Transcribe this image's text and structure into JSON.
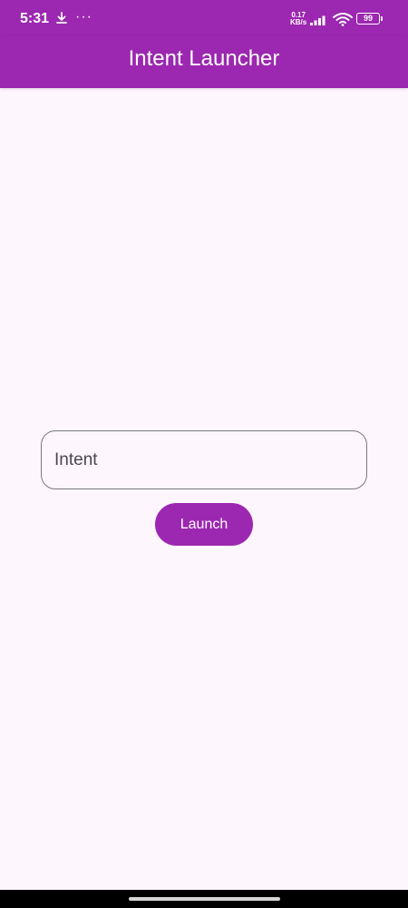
{
  "status_bar": {
    "time": "5:31",
    "more": "···",
    "net_speed_value": "0.17",
    "net_speed_unit": "KB/s",
    "battery": "99",
    "icons": [
      "download-icon",
      "more-icon",
      "signal-icon",
      "wifi-icon",
      "battery-icon"
    ]
  },
  "app_bar": {
    "title": "Intent Launcher",
    "color": "#9c27b0"
  },
  "form": {
    "intent_placeholder": "Intent",
    "intent_value": "",
    "launch_label": "Launch"
  },
  "colors": {
    "accent": "#9c27b0",
    "background": "#fdf6fd"
  }
}
